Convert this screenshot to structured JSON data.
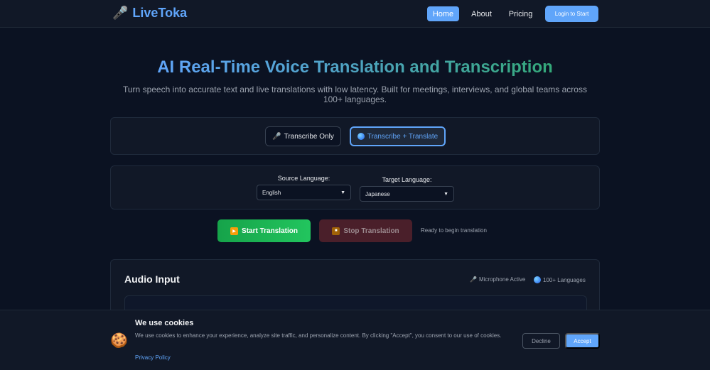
{
  "nav": {
    "logo_icon": "🎤",
    "logo_text": "LiveToka",
    "links": [
      "Home",
      "About",
      "Pricing"
    ],
    "login_label": "Login to Start"
  },
  "hero": {
    "title": "AI Real-Time Voice Translation and Transcription",
    "subtitle": "Turn speech into accurate text and live translations with low latency. Built for meetings, interviews, and global teams across 100+ languages."
  },
  "modes": {
    "transcribe_icon": "🎤",
    "transcribe_label": "Transcribe Only",
    "translate_label": "Transcribe + Translate"
  },
  "languages": {
    "source_label": "Source Language:",
    "source_value": "English",
    "target_label": "Target Language:",
    "target_value": "Japanese",
    "caret": "▼"
  },
  "actions": {
    "start_label": "Start Translation",
    "stop_label": "Stop Translation",
    "status": "Ready to begin translation",
    "play_glyph": "▶",
    "stop_glyph": "■"
  },
  "audio": {
    "title": "Audio Input",
    "mic_icon": "🎤",
    "mic_label": "Microphone Active",
    "lang_label": "100+ Languages"
  },
  "cookie": {
    "icon": "🍪",
    "title": "We use cookies",
    "text": "We use cookies to enhance your experience, analyze site traffic, and personalize content. By clicking \"Accept\", you consent to our use of cookies.",
    "link": "Privacy Policy",
    "decline_label": "Decline",
    "accept_label": "Accept"
  },
  "colors": {
    "accent": "#60a5fa",
    "start_green": "#22c55e",
    "stop_red": "#4a1f2a",
    "background": "#0b1222"
  }
}
